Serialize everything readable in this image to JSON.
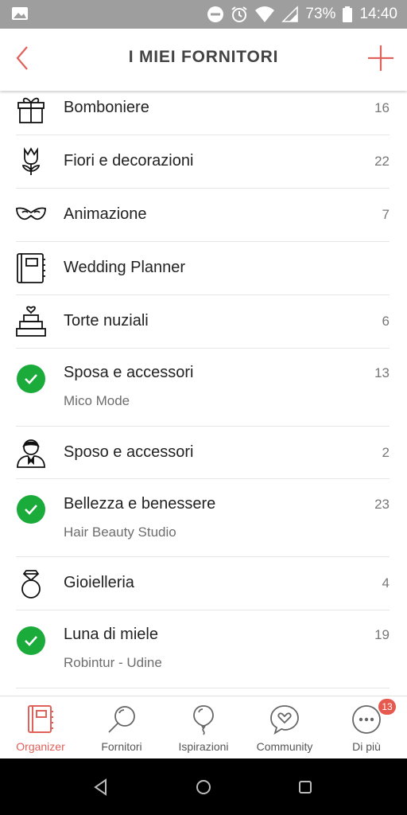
{
  "status_bar": {
    "battery": "73%",
    "time": "14:40"
  },
  "header": {
    "title": "I MIEI FORNITORI"
  },
  "colors": {
    "accent": "#e0605a",
    "check": "#1aab3a",
    "badge": "#e5594f"
  },
  "rows": [
    {
      "label": "Bomboniere",
      "count": "16",
      "icon": "gift-icon"
    },
    {
      "label": "Fiori e decorazioni",
      "count": "22",
      "icon": "flower-icon"
    },
    {
      "label": "Animazione",
      "count": "7",
      "icon": "mask-icon"
    },
    {
      "label": "Wedding Planner",
      "count": "",
      "icon": "planner-icon"
    },
    {
      "label": "Torte nuziali",
      "count": "6",
      "icon": "cake-icon"
    },
    {
      "label": "Sposa e accessori",
      "count": "13",
      "icon": "check-icon",
      "sub": "Mico Mode"
    },
    {
      "label": "Sposo e accessori",
      "count": "2",
      "icon": "groom-icon"
    },
    {
      "label": "Bellezza e benessere",
      "count": "23",
      "icon": "check-icon",
      "sub": "Hair Beauty Studio"
    },
    {
      "label": "Gioielleria",
      "count": "4",
      "icon": "ring-icon"
    },
    {
      "label": "Luna di miele",
      "count": "19",
      "icon": "check-icon",
      "sub": "Robintur - Udine"
    }
  ],
  "tabs": [
    {
      "label": "Organizer",
      "icon": "organizer-icon",
      "active": true
    },
    {
      "label": "Fornitori",
      "icon": "search-icon"
    },
    {
      "label": "Ispirazioni",
      "icon": "balloon-icon"
    },
    {
      "label": "Community",
      "icon": "chat-heart-icon"
    },
    {
      "label": "Di più",
      "icon": "more-icon",
      "badge": "13"
    }
  ]
}
